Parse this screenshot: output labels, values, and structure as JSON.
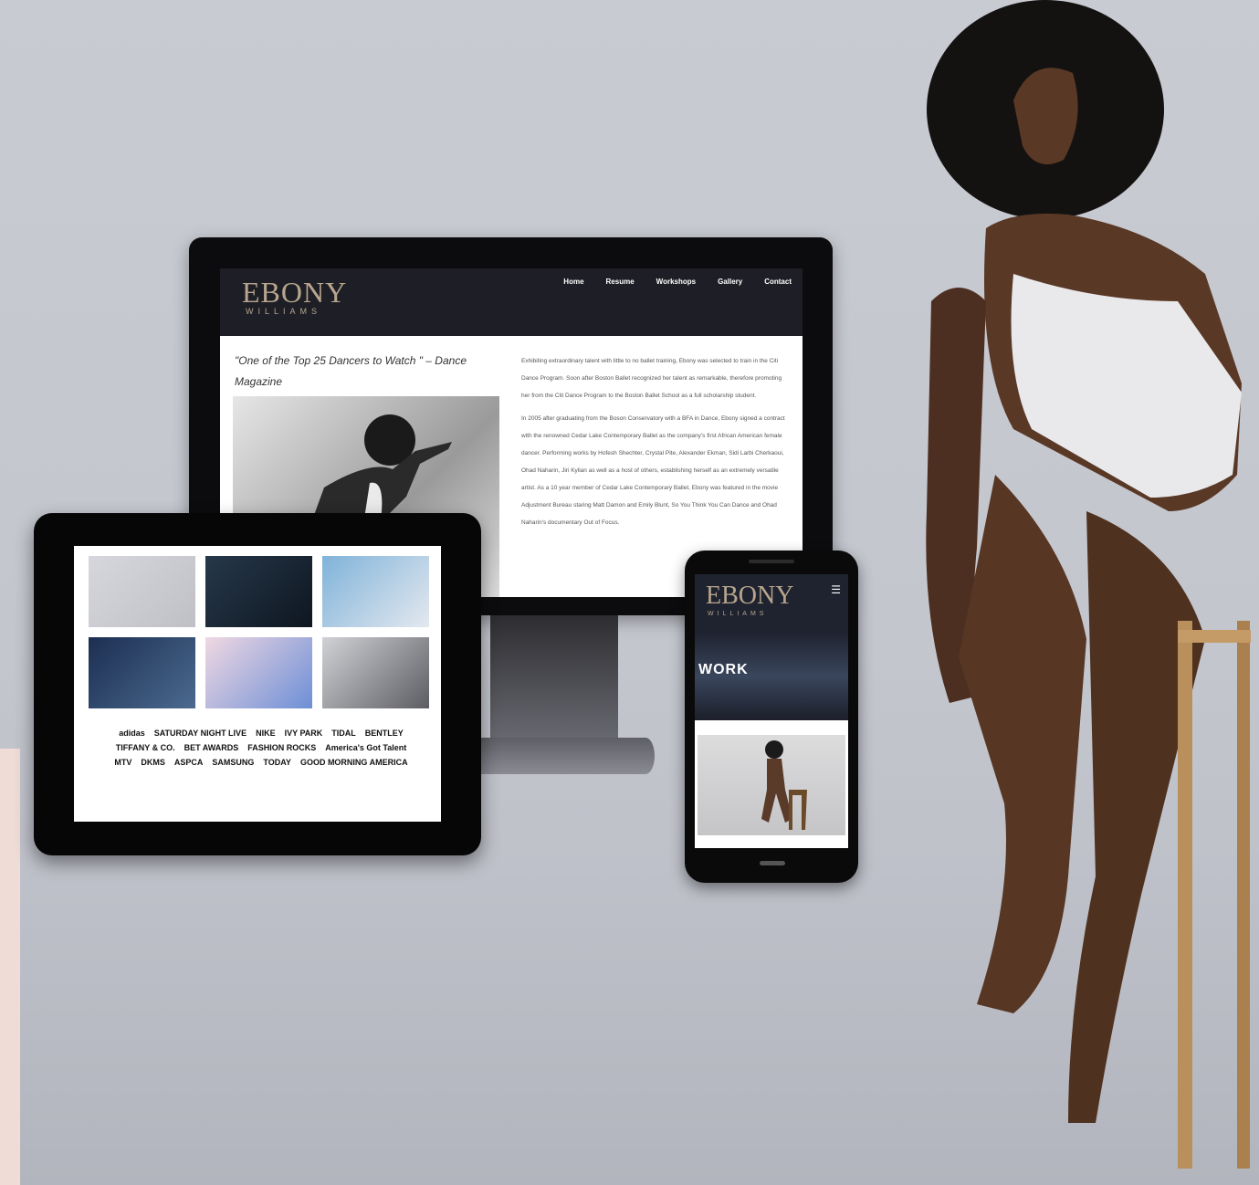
{
  "site": {
    "logo_main": "EBONY",
    "logo_sub": "WILLIAMS",
    "nav": [
      "Home",
      "Resume",
      "Workshops",
      "Gallery",
      "Contact"
    ]
  },
  "desktop": {
    "quote": "\"One of the Top 25 Dancers to Watch \" – Dance Magazine",
    "para1": "Exhibiting extraordinary talent with little to no ballet training, Ebony was selected to train in the Citi Dance Program. Soon after Boston Ballet recognized her talent as remarkable, therefore promoting her from the Citi Dance Program to the Boston Ballet School as a full scholarship student.",
    "para2": "In 2005 after graduating from the Boson Conservatory with a BFA in Dance, Ebony signed a contract with the renowned Cedar Lake Contemporary Ballet as the company's first African American female dancer. Performing works by Hofesh Shechter, Crystal Pite, Alexander Ekman, Sidi Larbi Cherkaoui, Ohad Naharin, Jiri Kylian as well as a host of others, establishing herself as an extremely versatile artist. As a 10 year member of Cedar Lake Contemporary Ballet, Ebony was featured in the movie Adjustment Bureau staring Matt Damon and Emily Blunt, So You Think You Can Dance and Ohad Naharin's documentary Out of Focus."
  },
  "tablet": {
    "brands": [
      "adidas",
      "SATURDAY NIGHT LIVE",
      "NIKE",
      "IVY PARK",
      "TIDAL",
      "BENTLEY",
      "TIFFANY & CO.",
      "BET AWARDS",
      "FASHION ROCKS",
      "America's Got Talent",
      "MTV",
      "DKMS",
      "ASPCA",
      "SAMSUNG",
      "TODAY",
      "GOOD MORNING AMERICA"
    ]
  },
  "phone": {
    "hero_text": "WORK"
  }
}
